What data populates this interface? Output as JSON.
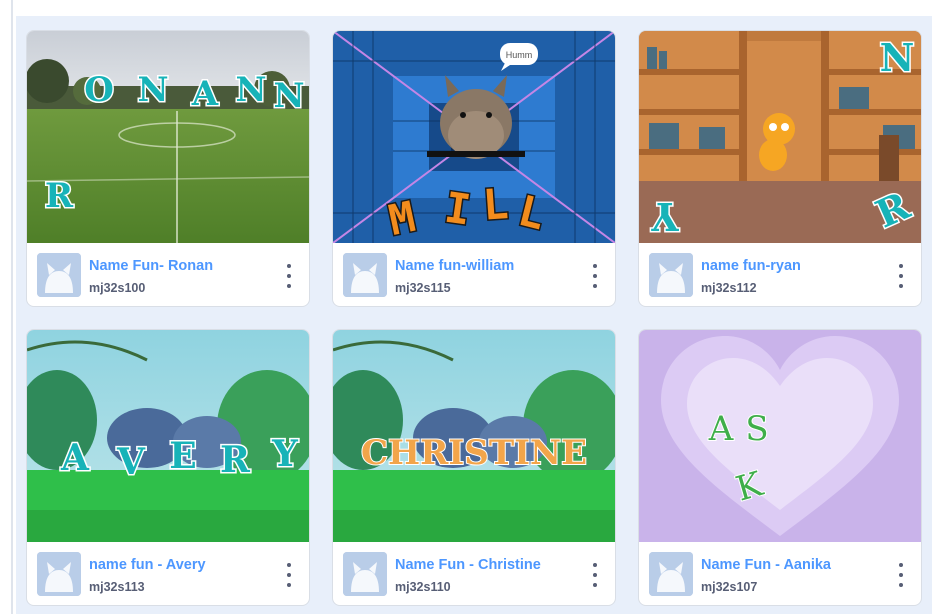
{
  "projects": [
    {
      "title": "Name Fun- Ronan",
      "username": "mj32s100",
      "thumb_letters": [
        "O",
        "N",
        "A",
        "N",
        "N",
        "R"
      ]
    },
    {
      "title": "Name fun-william",
      "username": "mj32s115",
      "thumb_letters": [
        "M",
        "I",
        "L",
        "L"
      ],
      "speech_bubble": "Humm"
    },
    {
      "title": "name fun-ryan",
      "username": "mj32s112",
      "thumb_letters": [
        "N",
        "Y",
        "R"
      ]
    },
    {
      "title": "name fun - Avery",
      "username": "mj32s113",
      "thumb_letters": [
        "A",
        "V",
        "E",
        "R",
        "Y"
      ]
    },
    {
      "title": "Name Fun - Christine",
      "username": "mj32s110",
      "thumb_text": "CHRISTINE"
    },
    {
      "title": "Name Fun - Aanika",
      "username": "mj32s107",
      "thumb_letters": [
        "A",
        "S",
        "K"
      ]
    }
  ],
  "colors": {
    "title_link": "#4d97ff",
    "username": "#575e75",
    "grid_background": "#e8effa"
  },
  "icons": {
    "avatar": "scratch-cat-avatar-icon",
    "menu": "more-vertical-icon"
  }
}
